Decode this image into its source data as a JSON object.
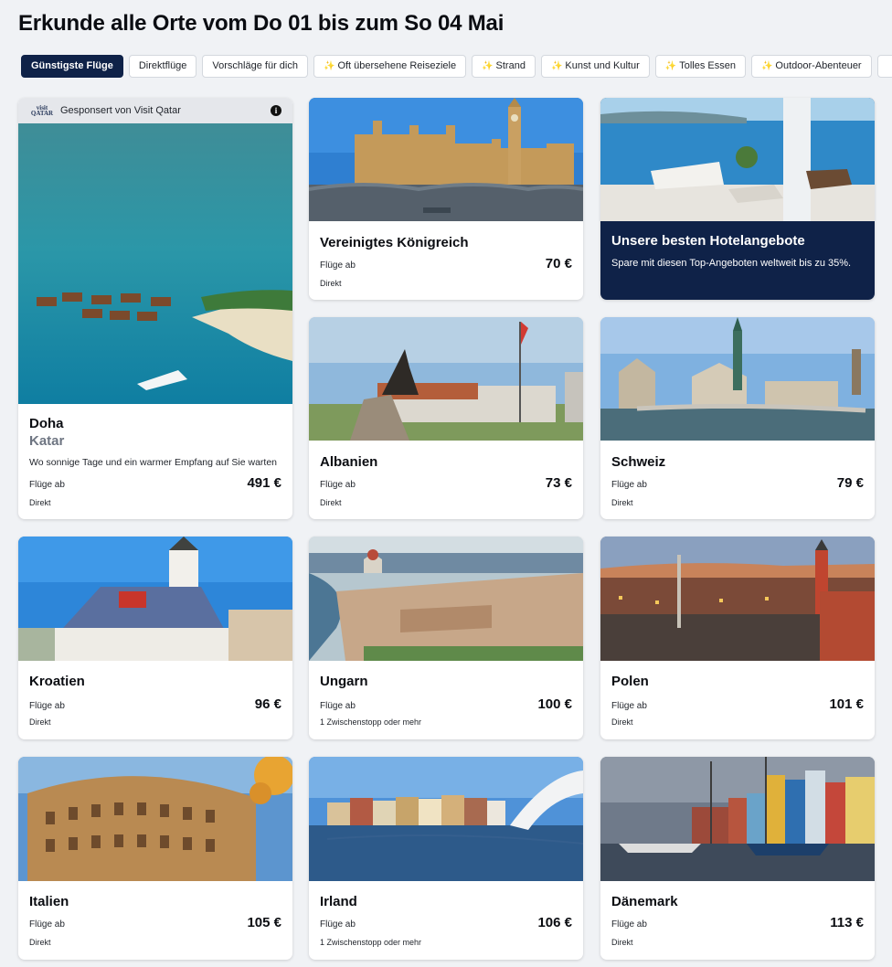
{
  "page": {
    "title": "Erkunde alle Orte vom Do 01 bis zum So 04 Mai"
  },
  "filters": [
    {
      "label": "Günstigste Flüge",
      "active": true,
      "spark": false
    },
    {
      "label": "Direktflüge",
      "active": false,
      "spark": false
    },
    {
      "label": "Vorschläge für dich",
      "active": false,
      "spark": false
    },
    {
      "label": "Oft übersehene Reiseziele",
      "active": false,
      "spark": true
    },
    {
      "label": "Strand",
      "active": false,
      "spark": true
    },
    {
      "label": "Kunst und Kultur",
      "active": false,
      "spark": true
    },
    {
      "label": "Tolles Essen",
      "active": false,
      "spark": true
    },
    {
      "label": "Outdoor-Abenteuer",
      "active": false,
      "spark": true
    }
  ],
  "sponsored": {
    "logo_top": "visit",
    "logo_bottom": "QATAR",
    "sponsor_text": "Gesponsert von Visit Qatar",
    "info_icon": "info-icon",
    "name": "Doha",
    "country": "Katar",
    "tagline": "Wo sonnige Tage und ein warmer Empfang auf Sie warten",
    "flights_label": "Flüge ab",
    "price": "491 €",
    "stops": "Direkt"
  },
  "hotel_promo": {
    "title": "Unsere besten Hotelangebote",
    "text": "Spare mit diesen Top-Angeboten weltweit bis zu 35%."
  },
  "destinations": [
    {
      "name": "Vereinigtes Königreich",
      "flights_label": "Flüge ab",
      "price": "70 €",
      "stops": "Direkt"
    },
    {
      "name": "Albanien",
      "flights_label": "Flüge ab",
      "price": "73 €",
      "stops": "Direkt"
    },
    {
      "name": "Schweiz",
      "flights_label": "Flüge ab",
      "price": "79 €",
      "stops": "Direkt"
    },
    {
      "name": "Kroatien",
      "flights_label": "Flüge ab",
      "price": "96 €",
      "stops": "Direkt"
    },
    {
      "name": "Ungarn",
      "flights_label": "Flüge ab",
      "price": "100 €",
      "stops": "1 Zwischenstopp oder mehr"
    },
    {
      "name": "Polen",
      "flights_label": "Flüge ab",
      "price": "101 €",
      "stops": "Direkt"
    },
    {
      "name": "Italien",
      "flights_label": "Flüge ab",
      "price": "105 €",
      "stops": "Direkt"
    },
    {
      "name": "Irland",
      "flights_label": "Flüge ab",
      "price": "106 €",
      "stops": "1 Zwischenstopp oder mehr"
    },
    {
      "name": "Dänemark",
      "flights_label": "Flüge ab",
      "price": "113 €",
      "stops": "Direkt"
    }
  ],
  "colors": {
    "accent": "#0f2248",
    "background": "#f0f2f5",
    "spark": "#e9b51f"
  }
}
